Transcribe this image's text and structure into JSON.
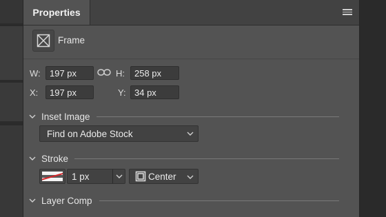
{
  "panel": {
    "tab_title": "Properties",
    "menu_icon": "hamburger-menu-icon"
  },
  "frame": {
    "icon": "frame-icon",
    "label": "Frame"
  },
  "transform": {
    "w_label": "W:",
    "w_value": "197 px",
    "link_icon": "link-icon",
    "h_label": "H:",
    "h_value": "258 px",
    "x_label": "X:",
    "x_value": "197 px",
    "y_label": "Y:",
    "y_value": "34 px"
  },
  "inset_image": {
    "section_title": "Inset Image",
    "dropdown_value": "Find on Adobe Stock"
  },
  "stroke": {
    "section_title": "Stroke",
    "swatch_color": "#d7262a",
    "width_value": "1 px",
    "align_value": "Center"
  },
  "layer_comp": {
    "section_title": "Layer Comp"
  }
}
